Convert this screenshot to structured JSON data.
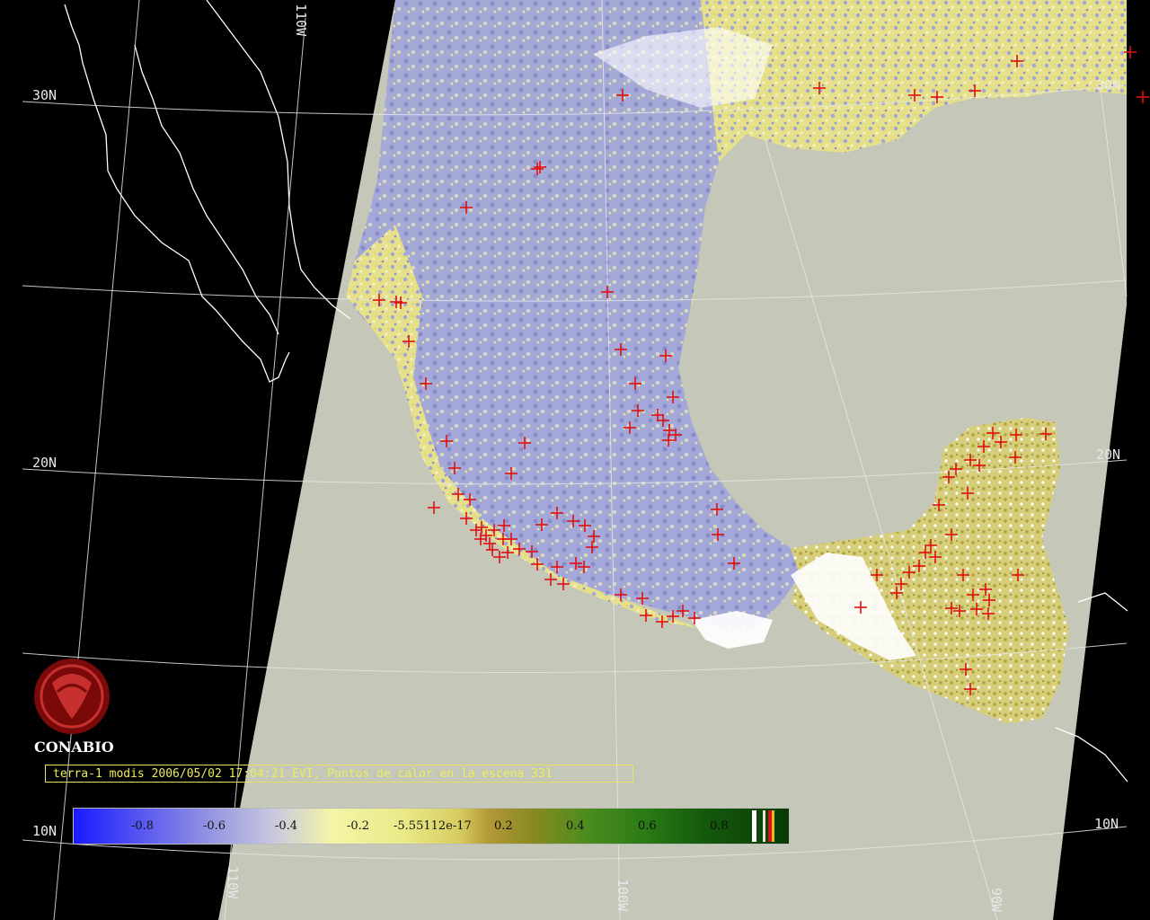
{
  "caption": "terra-1 modis 2006/05/02 17:04:21 EVI, Puntos de calor en la escena 331",
  "logo": {
    "text": "CONABIO"
  },
  "grid_labels": {
    "lon_110w_top": "110W",
    "lon_110w_bottom": "110W",
    "lon_100w": "100W",
    "lon_90w": "90W",
    "lat_30n_left": "30N",
    "lat_30n_right": "30N",
    "lat_20n_left": "20N",
    "lat_20n_right": "20N",
    "lat_10n_left": "10N",
    "lat_10n_right": "10N"
  },
  "colorbar": {
    "ticks": [
      "-0.8",
      "-0.6",
      "-0.4",
      "-0.2",
      "-5.55112e-17",
      "0.2",
      "0.4",
      "0.6",
      "0.8"
    ]
  },
  "colors": {
    "background": "#000000",
    "ocean_swath": "#c5c8b8",
    "land_dry": "#e6e08a",
    "land_low": "#9aa0d8",
    "land_cloud": "#ffffff",
    "hotspot": "#e01010",
    "grid": "#e6e6e6",
    "caption": "#ecec60",
    "logo": "#8a0c0c"
  }
}
